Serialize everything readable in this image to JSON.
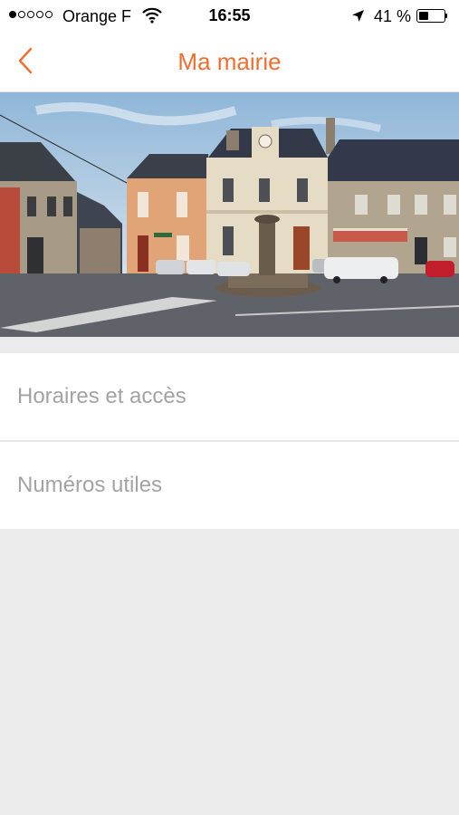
{
  "status_bar": {
    "signal_bars_filled": 1,
    "signal_bars_total": 5,
    "carrier": "Orange F",
    "time": "16:55",
    "battery_percent": "41 %",
    "battery_level": 0.41,
    "icons": [
      "wifi-icon",
      "location-arrow-icon",
      "battery-icon"
    ]
  },
  "nav": {
    "title": "Ma mairie",
    "back_icon": "chevron-left-icon",
    "accent_color": "#f16e32"
  },
  "hero": {
    "description_icon": "town-hall-photo"
  },
  "menu": {
    "items": [
      {
        "label": "Horaires et accès"
      },
      {
        "label": "Numéros utiles"
      }
    ]
  }
}
